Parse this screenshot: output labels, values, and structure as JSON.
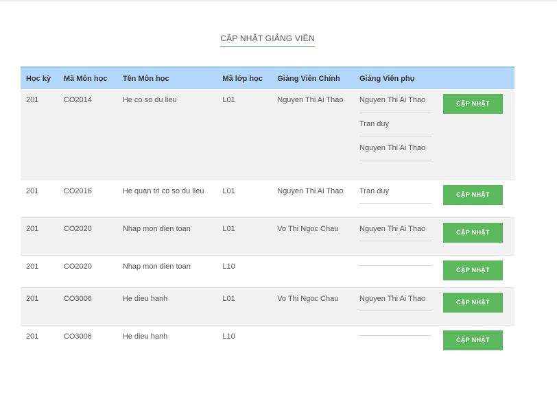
{
  "page": {
    "title": "CẬP NHẬT GIẢNG VIÊN"
  },
  "table": {
    "headers": [
      "Học kỳ",
      "Mã Môn học",
      "Tên Môn học",
      "Mã lớp học",
      "Giảng Viên Chính",
      "Giảng Viên phụ",
      ""
    ],
    "button_label": "CẬP NHẬT",
    "rows": [
      {
        "hoc_ky": "201",
        "ma_mon": "CO2014",
        "ten_mon": "He co so du lieu",
        "ma_lop": "L01",
        "gv_chinh": "Nguyen Thi Ai Thao",
        "gv_phu": [
          "Nguyen Thi Ai Thao",
          "Tran duy",
          "Nguyen Thi Ai Thao"
        ]
      },
      {
        "hoc_ky": "201",
        "ma_mon": "CO2016",
        "ten_mon": "He quan tri co so du lieu",
        "ma_lop": "L01",
        "gv_chinh": "Nguyen Thi Ai Thao",
        "gv_phu": [
          "Tran duy"
        ]
      },
      {
        "hoc_ky": "201",
        "ma_mon": "CO2020",
        "ten_mon": "Nhap mon dien toan",
        "ma_lop": "L01",
        "gv_chinh": "Vo Thi Ngoc Chau",
        "gv_phu": [
          "Nguyen Thi Ai Thao"
        ]
      },
      {
        "hoc_ky": "201",
        "ma_mon": "CO2020",
        "ten_mon": "Nhap mon dien toan",
        "ma_lop": "L10",
        "gv_chinh": "",
        "gv_phu": [
          ""
        ]
      },
      {
        "hoc_ky": "201",
        "ma_mon": "CO3006",
        "ten_mon": "He dieu hanh",
        "ma_lop": "L01",
        "gv_chinh": "Vo Thi Ngoc Chau",
        "gv_phu": [
          "Nguyen Thi Ai Thao"
        ]
      },
      {
        "hoc_ky": "201",
        "ma_mon": "CO3006",
        "ten_mon": "He dieu hanh",
        "ma_lop": "L10",
        "gv_chinh": "",
        "gv_phu": [
          ""
        ]
      }
    ]
  }
}
